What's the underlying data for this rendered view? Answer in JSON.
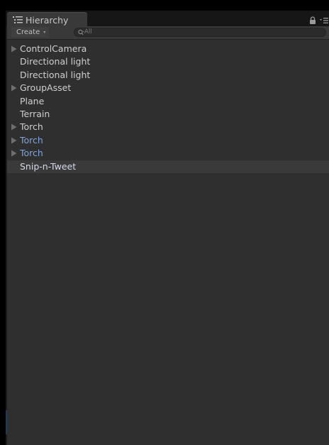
{
  "window": {
    "tab_label": "Hierarchy"
  },
  "toolbar": {
    "create_label": "Create",
    "create_caret": "▾",
    "search_placeholder": "All"
  },
  "hierarchy": {
    "items": [
      {
        "label": "ControlCamera",
        "expandable": true,
        "style": "normal"
      },
      {
        "label": "Directional light",
        "expandable": false,
        "style": "normal"
      },
      {
        "label": "Directional light",
        "expandable": false,
        "style": "normal"
      },
      {
        "label": "GroupAsset",
        "expandable": true,
        "style": "normal"
      },
      {
        "label": "Plane",
        "expandable": false,
        "style": "normal"
      },
      {
        "label": "Terrain",
        "expandable": false,
        "style": "normal"
      },
      {
        "label": "Torch",
        "expandable": true,
        "style": "normal"
      },
      {
        "label": "Torch",
        "expandable": true,
        "style": "prefab"
      },
      {
        "label": "Torch",
        "expandable": true,
        "style": "prefab"
      },
      {
        "label": "Snip-n-Tweet",
        "expandable": false,
        "style": "selected"
      }
    ]
  },
  "colors": {
    "background": "#2f2f2f",
    "prefab_text": "#7fa3dd",
    "normal_text": "#cfcfcf",
    "selected_row": "#3a3a3a"
  }
}
